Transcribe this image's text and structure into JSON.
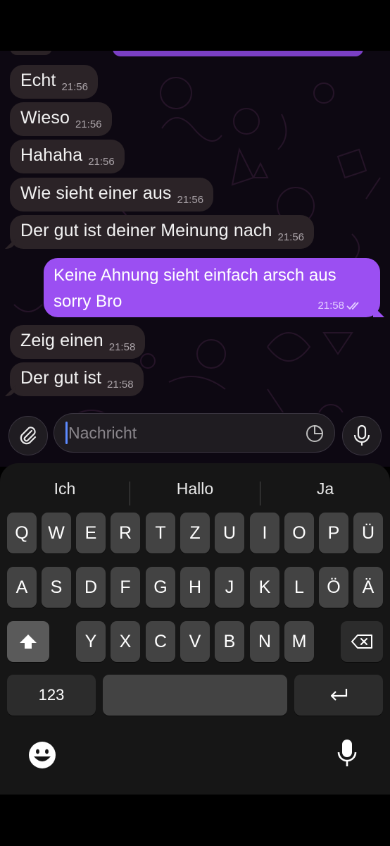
{
  "chat": {
    "incoming": [
      {
        "text": "Echt",
        "time": "21:56"
      },
      {
        "text": "Wieso",
        "time": "21:56"
      },
      {
        "text": "Hahaha",
        "time": "21:56"
      },
      {
        "text": "Wie sieht einer aus",
        "time": "21:56"
      },
      {
        "text": "Der gut ist deiner Meinung nach",
        "time": "21:56"
      },
      {
        "text": "Zeig einen",
        "time": "21:58"
      },
      {
        "text": "Der gut ist",
        "time": "21:58"
      }
    ],
    "outgoing": {
      "line1": "Keine Ahnung sieht einfach arsch aus",
      "line2": "sorry Bro",
      "time": "21:58",
      "status": "read"
    }
  },
  "input": {
    "placeholder": "Nachricht"
  },
  "icons": {
    "attach": "paperclip-icon",
    "sticker": "sticker-icon",
    "mic": "microphone-icon",
    "emoji": "emoji-icon",
    "dictation": "dictation-icon"
  },
  "keyboard": {
    "suggestions": [
      "Ich",
      "Hallo",
      "Ja"
    ],
    "row1": [
      "Q",
      "W",
      "E",
      "R",
      "T",
      "Z",
      "U",
      "I",
      "O",
      "P",
      "Ü"
    ],
    "row2": [
      "A",
      "S",
      "D",
      "F",
      "G",
      "H",
      "J",
      "K",
      "L",
      "Ö",
      "Ä"
    ],
    "row3": [
      "Y",
      "X",
      "C",
      "V",
      "B",
      "N",
      "M"
    ],
    "numbers_label": "123"
  },
  "colors": {
    "outgoing_bubble": "#9b4ff2",
    "incoming_bubble": "#2b2327",
    "caret": "#5c8aff"
  }
}
